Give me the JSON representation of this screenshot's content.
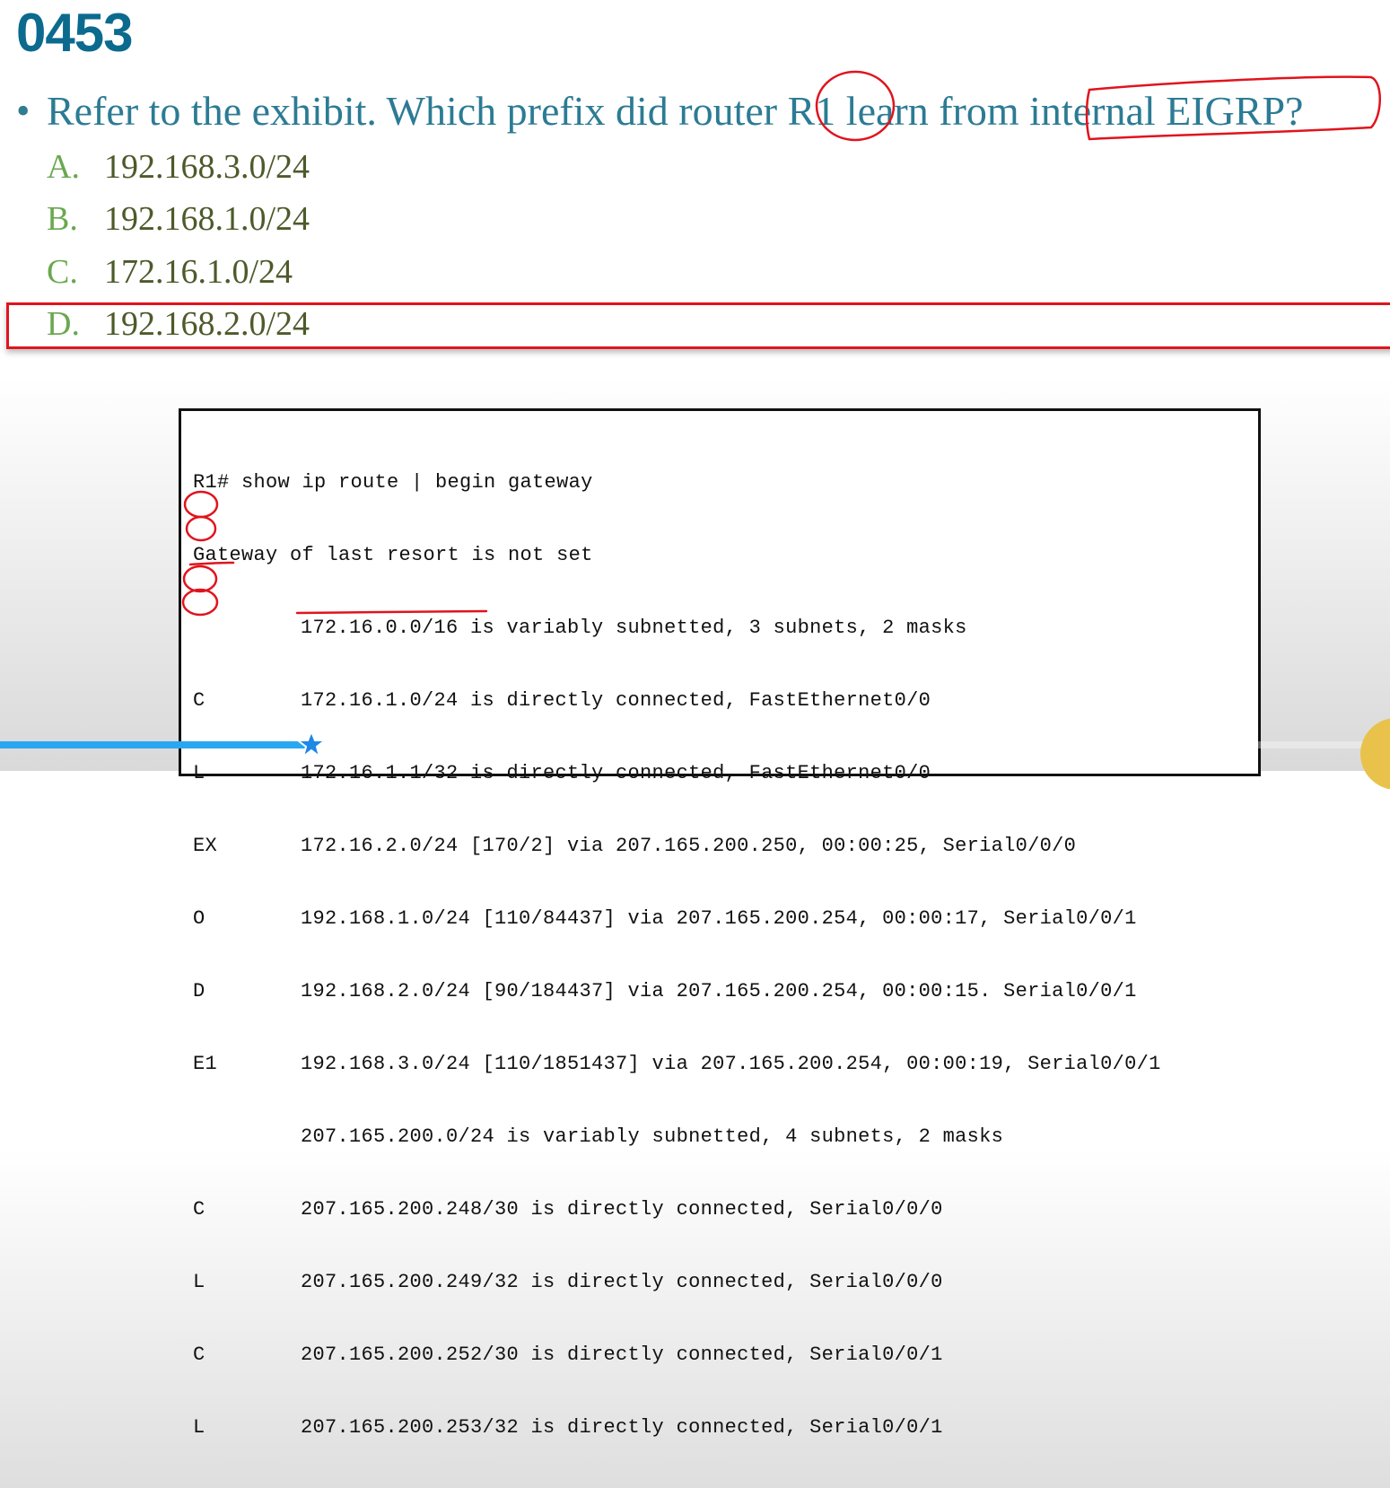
{
  "title": "0453",
  "question": {
    "bullet": "•",
    "text": "Refer to the exhibit. Which prefix did router R1 learn from internal EIGRP?"
  },
  "options": [
    {
      "letter": "A.",
      "text": "192.168.3.0/24",
      "correct": false
    },
    {
      "letter": "B.",
      "text": "192.168.1.0/24",
      "correct": false
    },
    {
      "letter": "C.",
      "text": "172.16.1.0/24",
      "correct": false
    },
    {
      "letter": "D.",
      "text": "192.168.2.0/24",
      "correct": true
    }
  ],
  "exhibit": {
    "lines": [
      {
        "code": "",
        "text": "R1# show ip route | begin gateway",
        "header": true
      },
      {
        "code": "",
        "text": "Gateway of last resort is not set",
        "header": true
      },
      {
        "code": "",
        "text": "172.16.0.0/16 is variably subnetted, 3 subnets, 2 masks"
      },
      {
        "code": "C",
        "text": "172.16.1.0/24 is directly connected, FastEthernet0/0"
      },
      {
        "code": "L",
        "text": "172.16.1.1/32 is directly connected, FastEthernet0/0"
      },
      {
        "code": "EX",
        "text": "172.16.2.0/24 [170/2] via 207.165.200.250, 00:00:25, Serial0/0/0"
      },
      {
        "code": "O",
        "text": "192.168.1.0/24 [110/84437] via 207.165.200.254, 00:00:17, Serial0/0/1"
      },
      {
        "code": "D",
        "text": "192.168.2.0/24 [90/184437] via 207.165.200.254, 00:00:15. Serial0/0/1"
      },
      {
        "code": "E1",
        "text": "192.168.3.0/24 [110/1851437] via 207.165.200.254, 00:00:19, Serial0/0/1"
      },
      {
        "code": "",
        "text": "207.165.200.0/24 is variably subnetted, 4 subnets, 2 masks"
      },
      {
        "code": "C",
        "text": "207.165.200.248/30 is directly connected, Serial0/0/0"
      },
      {
        "code": "L",
        "text": "207.165.200.249/32 is directly connected, Serial0/0/0"
      },
      {
        "code": "C",
        "text": "207.165.200.252/30 is directly connected, Serial0/0/1"
      },
      {
        "code": "L",
        "text": "207.165.200.253/32 is directly connected, Serial0/0/1"
      }
    ]
  },
  "video": {
    "progress_fraction": 0.224,
    "progress_color": "#2aa7f0",
    "annotation_color": "#e0141d"
  }
}
